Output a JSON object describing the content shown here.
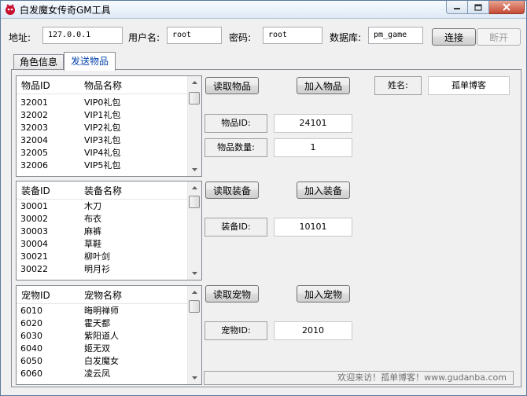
{
  "window": {
    "title": "白发魔女传奇GM工具"
  },
  "connection": {
    "address_label": "地址:",
    "address_value": "127.0.0.1",
    "username_label": "用户名:",
    "username_value": "root",
    "password_label": "密码:",
    "password_value": "root",
    "database_label": "数据库:",
    "database_value": "pm_game",
    "connect_button": "连接",
    "disconnect_button": "断开"
  },
  "tabs": [
    {
      "label": "角色信息",
      "active": false
    },
    {
      "label": "发送物品",
      "active": true
    }
  ],
  "items": {
    "col_id": "物品ID",
    "col_name": "物品名称",
    "rows": [
      {
        "id": "32001",
        "name": "VIP0礼包"
      },
      {
        "id": "32002",
        "name": "VIP1礼包"
      },
      {
        "id": "32003",
        "name": "VIP2礼包"
      },
      {
        "id": "32004",
        "name": "VIP3礼包"
      },
      {
        "id": "32005",
        "name": "VIP4礼包"
      },
      {
        "id": "32006",
        "name": "VIP5礼包"
      }
    ],
    "read_button": "读取物品",
    "add_button": "加入物品",
    "id_label": "物品ID:",
    "id_value": "24101",
    "qty_label": "物品数量:",
    "qty_value": "1"
  },
  "equipment": {
    "col_id": "装备ID",
    "col_name": "装备名称",
    "rows": [
      {
        "id": "30001",
        "name": "木刀"
      },
      {
        "id": "30002",
        "name": "布衣"
      },
      {
        "id": "30003",
        "name": "麻裤"
      },
      {
        "id": "30004",
        "name": "草鞋"
      },
      {
        "id": "30021",
        "name": "柳叶剑"
      },
      {
        "id": "30022",
        "name": "明月衫"
      }
    ],
    "read_button": "读取装备",
    "add_button": "加入装备",
    "id_label": "装备ID:",
    "id_value": "10101"
  },
  "pets": {
    "col_id": "宠物ID",
    "col_name": "宠物名称",
    "rows": [
      {
        "id": "6010",
        "name": "晦明禅师"
      },
      {
        "id": "6020",
        "name": "霍天都"
      },
      {
        "id": "6030",
        "name": "紫阳道人"
      },
      {
        "id": "6040",
        "name": "姬无双"
      },
      {
        "id": "6050",
        "name": "白发魔女"
      },
      {
        "id": "6060",
        "name": "凌云凤"
      }
    ],
    "read_button": "读取宠物",
    "add_button": "加入宠物",
    "id_label": "宠物ID:",
    "id_value": "2010"
  },
  "player": {
    "name_label": "姓名:",
    "name_value": "孤单博客"
  },
  "status_text": "欢迎来访！孤单博客！www.gudanba.com",
  "colors": {
    "active_tab_text": "#0645ad",
    "window_border": "#5a7a9b"
  }
}
